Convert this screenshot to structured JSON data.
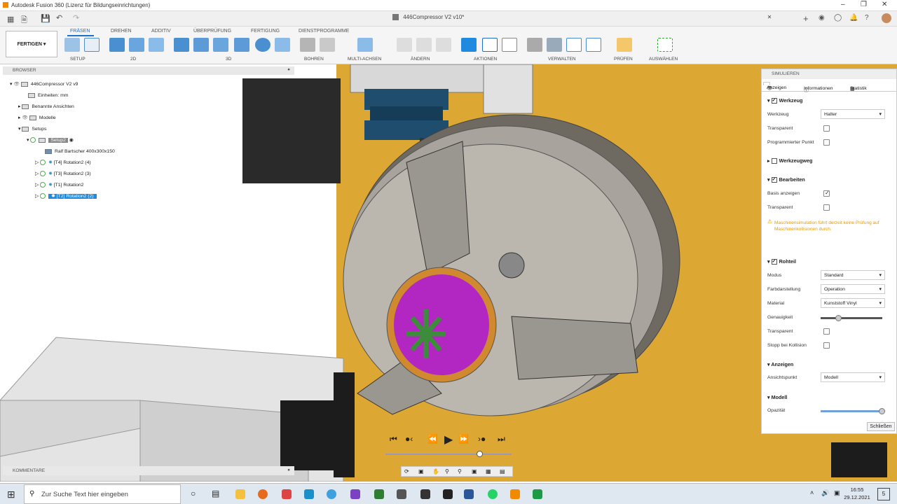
{
  "window": {
    "title": "Autodesk Fusion 360 (Lizenz für Bildungseinrichtungen)"
  },
  "document": {
    "tab_title": "446Compressor V2 v10*"
  },
  "ribbon": {
    "workspace": "FERTIGEN",
    "tabs": [
      "FRÄSEN",
      "DREHEN",
      "ADDITIV",
      "ÜBERPRÜFUNG",
      "FERTIGUNG",
      "DIENSTPROGRAMME"
    ],
    "active_tab": "FRÄSEN",
    "groups": [
      "SETUP",
      "2D",
      "3D",
      "BOHREN",
      "MULTI-ACHSEN",
      "ÄNDERN",
      "AKTIONEN",
      "VERWALTEN",
      "PRÜFEN",
      "AUSWÄHLEN"
    ]
  },
  "browser": {
    "header": "BROWSER",
    "root": "446Compressor V2 v9",
    "units": "Einheiten: mm",
    "named_views": "Benannte Ansichten",
    "models": "Modelle",
    "setups": "Setups",
    "setup2": "Setup2",
    "stock": "Ralf Bartscher 400x300x150",
    "operations": [
      "[T4] Rotation2 (4)",
      "[T3] Rotation2 (3)",
      "[T1] Rotation2",
      "[T2] Rotation2 (2)"
    ]
  },
  "comments": {
    "label": "KOMMENTARE"
  },
  "simulate": {
    "header": "SIMULIEREN",
    "tabs": [
      "Anzeigen",
      "Informationen",
      "Statistik"
    ],
    "werkzeug": {
      "title": "Werkzeug",
      "label_werkzeug": "Werkzeug",
      "werkzeug_value": "Halter",
      "transparent": "Transparent",
      "prog_punkt": "Programmierter Punkt"
    },
    "werkzeugweg": {
      "title": "Werkzeugweg"
    },
    "bearbeiten": {
      "title": "Bearbeiten",
      "basis": "Basis anzeigen",
      "transparent": "Transparent",
      "warning": "Maschinensimulation führt derzeit keine Prüfung auf Maschinenkollisionen durch."
    },
    "rohteil": {
      "title": "Rohteil",
      "modus": "Modus",
      "modus_value": "Standard",
      "farbdarstellung": "Farbdarstellung",
      "farb_value": "Operation",
      "material": "Material",
      "material_value": "Kunststoff Vinyl",
      "genauigkeit": "Genauigkeit",
      "genauigkeit_level": 0.3,
      "transparent": "Transparent",
      "stopp": "Stopp bei Kollision"
    },
    "anzeigen": {
      "title": "Anzeigen",
      "ansichtspunkt": "Ansichtspunkt",
      "ansicht_value": "Modell"
    },
    "modell": {
      "title": "Modell",
      "opazitaet": "Opazität",
      "opazitaet_level": 1.0
    },
    "close": "Schließen"
  },
  "taskbar": {
    "search_placeholder": "Zur Suche Text hier eingeben",
    "time": "16:55",
    "date": "29.12.2021",
    "notifications": "5"
  }
}
